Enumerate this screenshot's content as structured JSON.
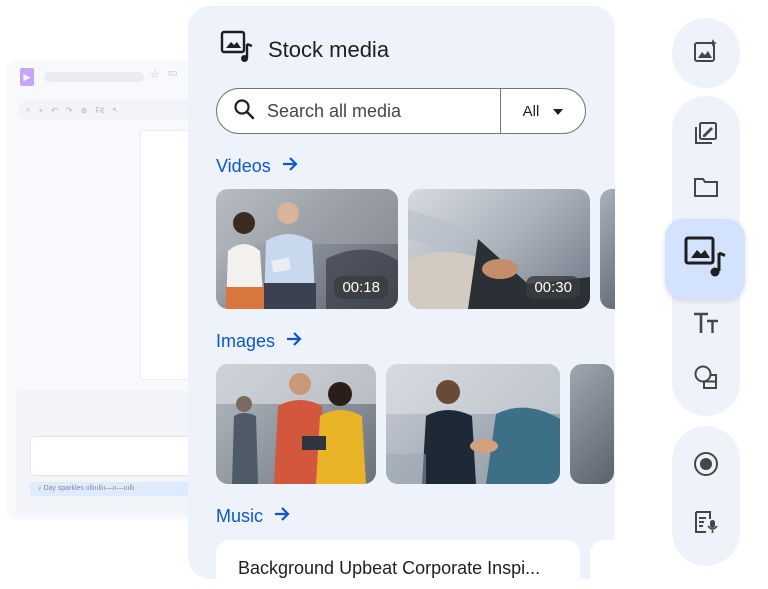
{
  "ghost_editor": {
    "zoom_label": "Fit",
    "audio_clip_label": "Day sparkles"
  },
  "panel": {
    "title": "Stock media",
    "search": {
      "placeholder": "Search all media",
      "filter_value": "All"
    },
    "sections": {
      "videos": {
        "label": "Videos",
        "items": [
          {
            "duration": "00:18"
          },
          {
            "duration": "00:30"
          }
        ]
      },
      "images": {
        "label": "Images"
      },
      "music": {
        "label": "Music",
        "items": [
          {
            "title": "Background Upbeat Corporate Inspi..."
          }
        ]
      }
    }
  },
  "rail": {
    "items": [
      {
        "icon": "image-sparkle-icon"
      },
      {
        "icon": "edit-gallery-icon"
      },
      {
        "icon": "folder-icon"
      },
      {
        "icon": "stock-media-icon",
        "active": true
      },
      {
        "icon": "text-size-icon"
      },
      {
        "icon": "shapes-icon"
      },
      {
        "icon": "record-icon"
      },
      {
        "icon": "script-icon"
      }
    ]
  },
  "colors": {
    "accent": "#0b57d0",
    "panel_bg": "#eef2fa",
    "active_bg": "#d3e3fd"
  }
}
